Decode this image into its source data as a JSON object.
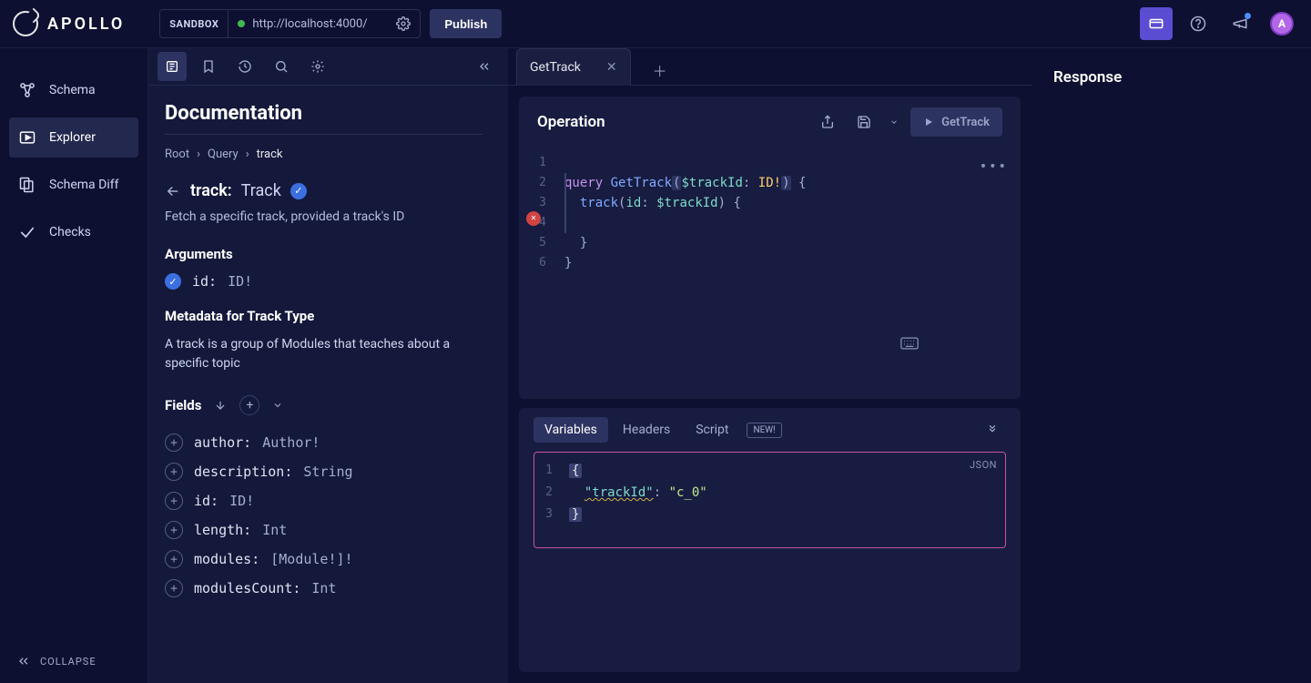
{
  "brand": "APOLLO",
  "sandbox": {
    "label": "SANDBOX",
    "url": "http://localhost:4000/"
  },
  "publish_label": "Publish",
  "avatar_initial": "A",
  "nav": {
    "schema": "Schema",
    "explorer": "Explorer",
    "schema_diff": "Schema Diff",
    "checks": "Checks",
    "collapse": "COLLAPSE"
  },
  "doc": {
    "title": "Documentation",
    "crumbs": {
      "root": "Root",
      "query": "Query",
      "current": "track"
    },
    "track_name": "track:",
    "track_type": "Track",
    "description": "Fetch a specific track, provided a track's ID",
    "arguments_h": "Arguments",
    "arg_id_name": "id:",
    "arg_id_type": "ID!",
    "metadata_h": "Metadata for Track Type",
    "metadata_text": "A track is a group of Modules that teaches about a specific topic",
    "fields_h": "Fields",
    "fields": [
      {
        "name": "author:",
        "type": "Author!"
      },
      {
        "name": "description:",
        "type": "String"
      },
      {
        "name": "id:",
        "type": "ID!"
      },
      {
        "name": "length:",
        "type": "Int"
      },
      {
        "name": "modules:",
        "type": "[Module!]!"
      },
      {
        "name": "modulesCount:",
        "type": "Int"
      }
    ]
  },
  "tab": {
    "name": "GetTrack"
  },
  "operation": {
    "title": "Operation",
    "run_label": "GetTrack",
    "code": {
      "l1_kw": "query",
      "l1_fn": "GetTrack",
      "l1_var": "$trackId",
      "l1_typ": "ID!",
      "l2_field": "track",
      "l2_arg": "id",
      "l2_var": "$trackId"
    }
  },
  "variables": {
    "tabs": {
      "variables": "Variables",
      "headers": "Headers",
      "script": "Script",
      "new": "NEW!"
    },
    "json_label": "JSON",
    "key": "\"trackId\"",
    "value": "\"c_0\""
  },
  "response": {
    "title": "Response"
  }
}
